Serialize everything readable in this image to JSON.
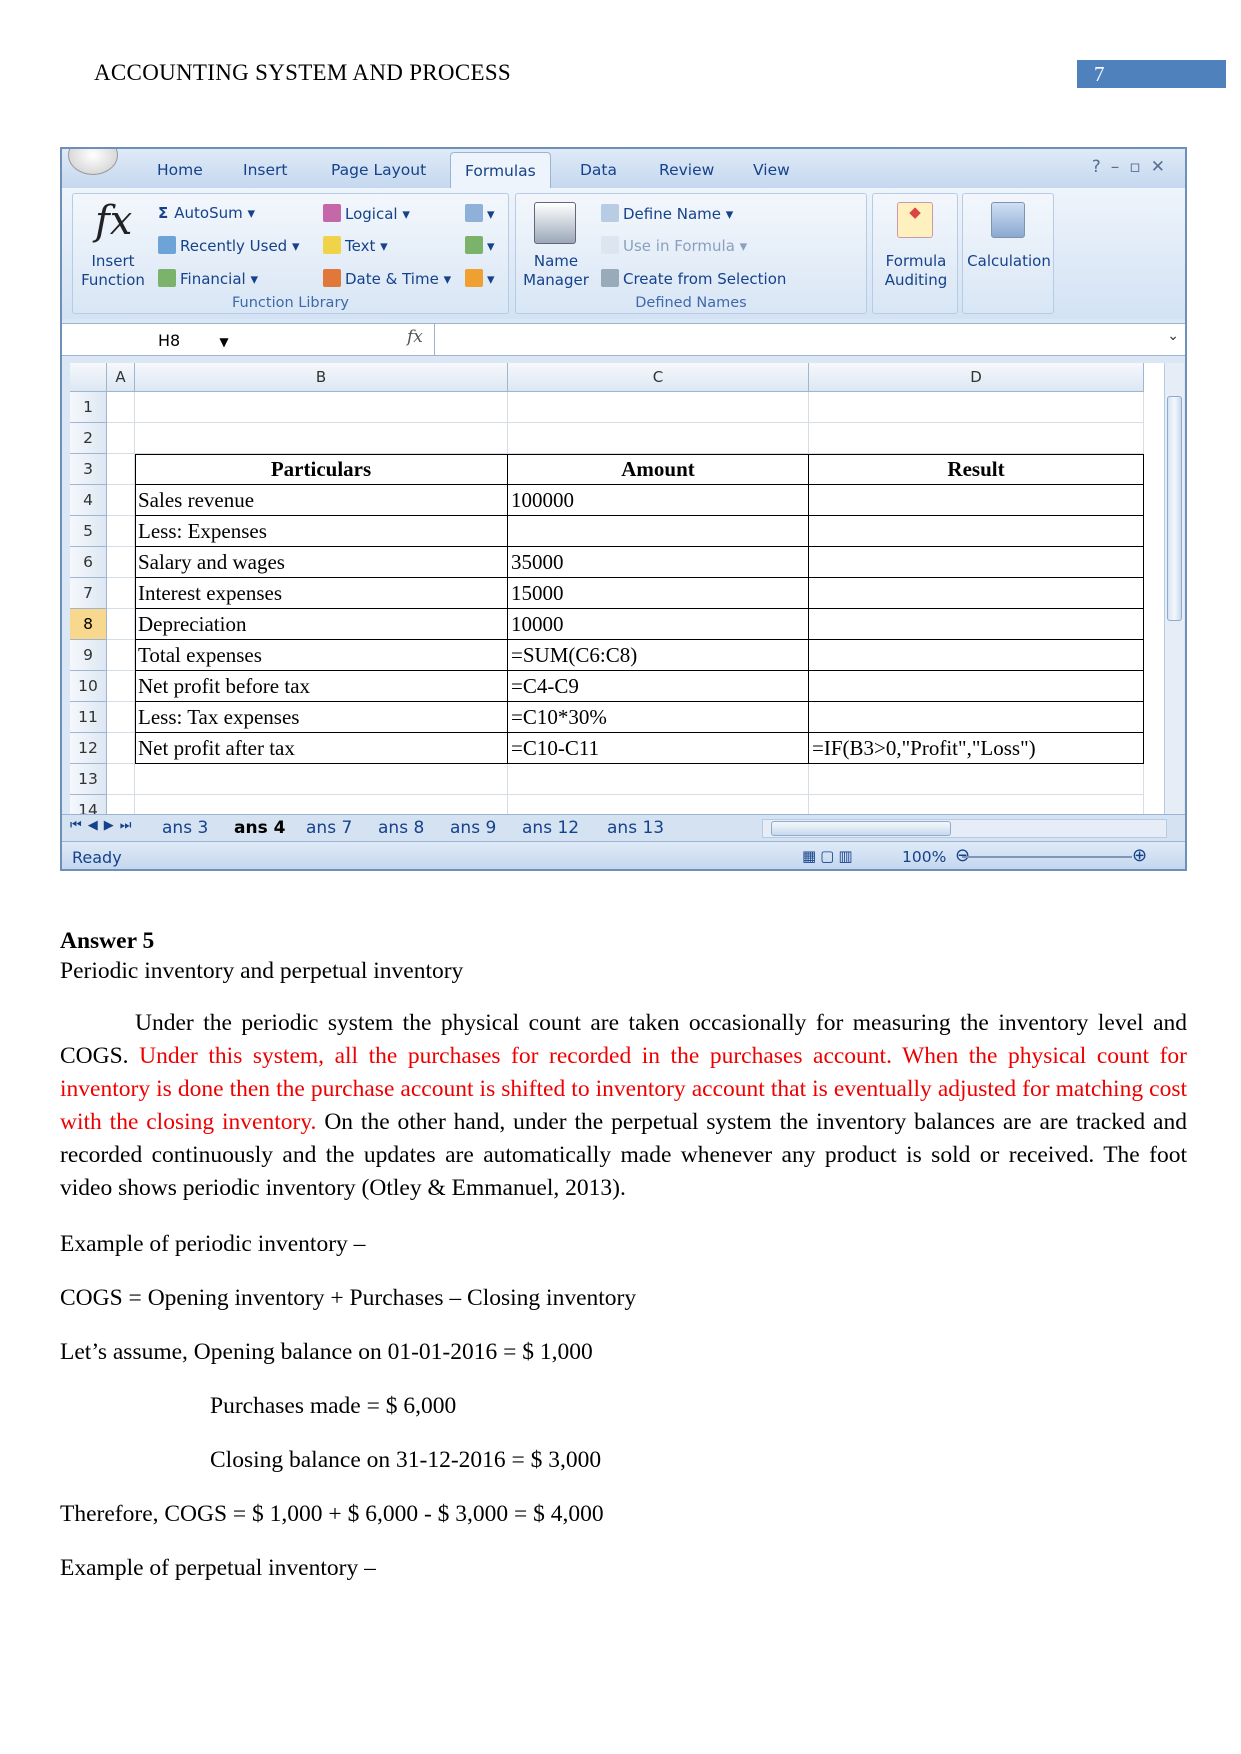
{
  "header": {
    "title": "ACCOUNTING SYSTEM AND PROCESS",
    "page_number": "7",
    "page_number_bg": "#4f81bd"
  },
  "excel": {
    "ribbon_tabs": [
      "Home",
      "Insert",
      "Page Layout",
      "Formulas",
      "Data",
      "Review",
      "View"
    ],
    "active_tab": "Formulas",
    "function_library": {
      "insert_function": "Insert Function",
      "autosum": "AutoSum",
      "recently_used": "Recently Used",
      "financial": "Financial",
      "logical": "Logical",
      "text": "Text",
      "date_time": "Date & Time",
      "group_label": "Function Library"
    },
    "defined_names": {
      "name_manager": "Name Manager",
      "define_name": "Define Name",
      "use_in_formula": "Use in Formula",
      "create_from_selection": "Create from Selection",
      "group_label": "Defined Names"
    },
    "formula_auditing": "Formula Auditing",
    "calculation": "Calculation",
    "name_box": "H8",
    "fx_label": "fx",
    "formula_value": "",
    "columns": [
      "A",
      "B",
      "C",
      "D"
    ],
    "rows": [
      "1",
      "2",
      "3",
      "4",
      "5",
      "6",
      "7",
      "8",
      "9",
      "10",
      "11",
      "12",
      "13",
      "14"
    ],
    "selected_row": "8",
    "table": {
      "headers": [
        "Particulars",
        "Amount",
        "Result"
      ],
      "rows": [
        [
          "Sales revenue",
          "100000",
          ""
        ],
        [
          "Less: Expenses",
          "",
          ""
        ],
        [
          "Salary and wages",
          "35000",
          ""
        ],
        [
          "Interest expenses",
          "15000",
          ""
        ],
        [
          "Depreciation",
          "10000",
          ""
        ],
        [
          "Total expenses",
          "=SUM(C6:C8)",
          ""
        ],
        [
          "Net profit before tax",
          "=C4-C9",
          ""
        ],
        [
          "Less: Tax expenses",
          "=C10*30%",
          ""
        ],
        [
          "Net profit after tax",
          "=C10-C11",
          "=IF(B3>0,\"Profit\",\"Loss\")"
        ]
      ]
    },
    "sheet_tabs": [
      "ans 3",
      "ans 4",
      "ans 7",
      "ans 8",
      "ans 9",
      "ans 12",
      "ans 13"
    ],
    "active_sheet": "ans 4",
    "status": "Ready",
    "zoom": "100%"
  },
  "body": {
    "heading": "Answer 5",
    "subheading": "Periodic inventory and perpetual inventory",
    "para_1": "Under the periodic system the physical count are taken occasionally for measuring the inventory level and COGS. ",
    "para_red": "Under this system, all the purchases for recorded in the purchases account. When the physical count for inventory is done then the purchase account is shifted to inventory account that is eventually adjusted for matching cost with the closing inventory.",
    "para_2": "  On the other hand, under the perpetual system the inventory balances are are tracked and recorded continuously and the updates are automatically made whenever any product is sold or received. The foot video shows periodic inventory (Otley & Emmanuel, 2013).",
    "lines": [
      "Example of periodic inventory –",
      "COGS = Opening inventory + Purchases – Closing inventory",
      "Let’s assume, Opening balance on 01-01-2016 = $ 1,000",
      "Purchases made = $ 6,000",
      "Closing balance on 31-12-2016 = $ 3,000",
      "Therefore, COGS = $ 1,000 + $ 6,000 - $ 3,000 = $ 4,000",
      "Example of perpetual inventory –"
    ],
    "red_color": "#e00000"
  }
}
